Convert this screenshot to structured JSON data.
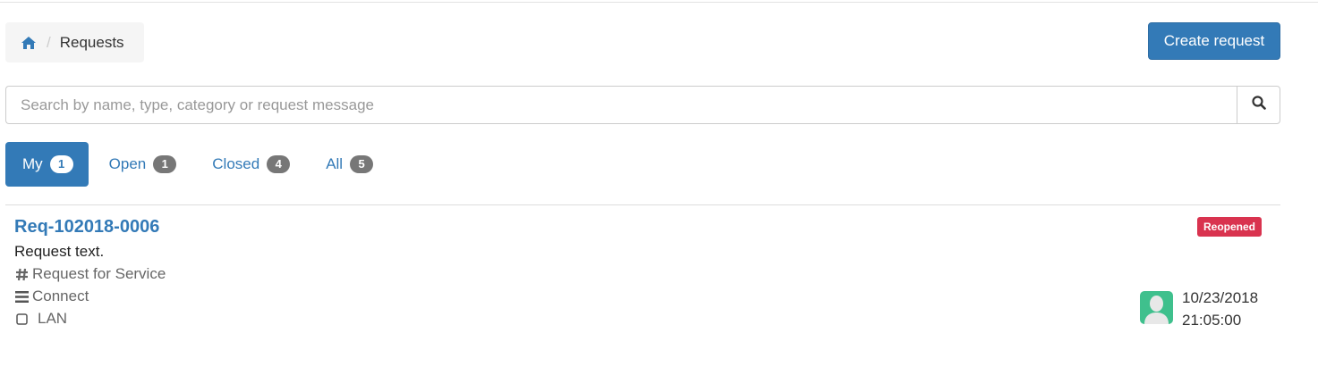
{
  "breadcrumb": {
    "home_icon": "home-icon",
    "separator": "/",
    "current": "Requests"
  },
  "toolbar": {
    "create_label": "Create request"
  },
  "search": {
    "placeholder": "Search by name, type, category or request message",
    "value": "",
    "button_icon": "search-icon"
  },
  "tabs": [
    {
      "label": "My",
      "count": "1",
      "active": true
    },
    {
      "label": "Open",
      "count": "1",
      "active": false
    },
    {
      "label": "Closed",
      "count": "4",
      "active": false
    },
    {
      "label": "All",
      "count": "5",
      "active": false
    }
  ],
  "requests": [
    {
      "id": "Req-102018-0006",
      "text": "Request text.",
      "type": "Request for Service",
      "type_icon": "hash-icon",
      "category": "Connect",
      "category_icon": "bars-icon",
      "subcategory": "LAN",
      "subcategory_icon": "square-icon",
      "status": "Reopened",
      "date": "10/23/2018",
      "time": "21:05:00",
      "avatar_icon": "avatar-icon"
    }
  ],
  "colors": {
    "primary": "#337ab7",
    "status_reopened": "#d9334f",
    "avatar_bg": "#3fc08d",
    "badge_gray": "#777777"
  }
}
